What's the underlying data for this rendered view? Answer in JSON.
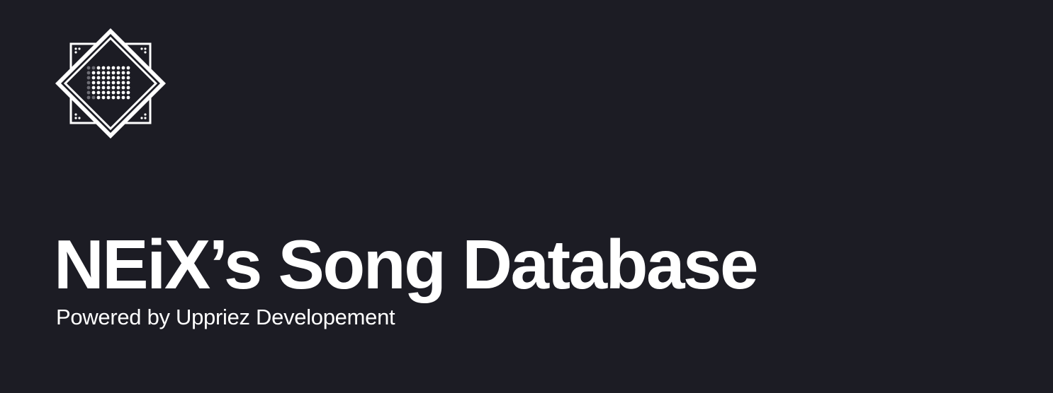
{
  "banner": {
    "title": "NEiX’s Song Database",
    "subtitle": "Powered by Uppriez Developement",
    "logo_icon": "diamond-dot-matrix-icon"
  },
  "colors": {
    "background": "#1c1c24",
    "foreground": "#ffffff"
  }
}
